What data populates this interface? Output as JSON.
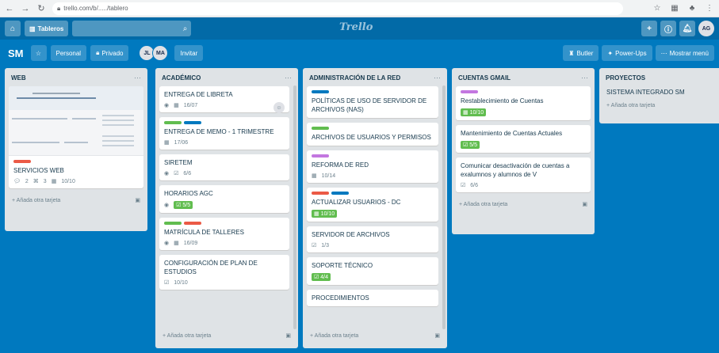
{
  "browser": {
    "url": "trello.com/b/...../tablero"
  },
  "header": {
    "boards_label": "Tableros",
    "logo": "Trello",
    "avatar_initials": "AG"
  },
  "board": {
    "title": "SM",
    "personal": "Personal",
    "privado": "Privado",
    "members": [
      "JL",
      "MA"
    ],
    "invite": "Invitar",
    "butler": "Butler",
    "power_ups": "Power-Ups",
    "show_menu": "Mostrar menú"
  },
  "colors": {
    "green": "#61bd4f",
    "blue": "#0079bf",
    "red": "#eb5a46",
    "purple": "#c377e0"
  },
  "lists": [
    {
      "title": "WEB",
      "cards": [
        {
          "title": "SERVICIOS WEB",
          "labels": [
            "red"
          ],
          "badges": {
            "comments": "2",
            "checklist": "3",
            "date": "10/10"
          }
        }
      ],
      "add": "Añada otra tarjeta"
    },
    {
      "title": "ACADÉMICO",
      "cards": [
        {
          "title": "ENTREGA DE LIBRETA",
          "labels": [],
          "date": "16/07"
        },
        {
          "title": "ENTREGA DE MEMO - 1 TRIMESTRE",
          "labels": [
            "green",
            "blue"
          ],
          "date": "17/06"
        },
        {
          "title": "SIRETEM",
          "labels": [],
          "date": "6/6"
        },
        {
          "title": "HORARIOS AGC",
          "labels": [],
          "date": "5/5"
        },
        {
          "title": "MATRÍCULA DE TALLERES",
          "labels": [
            "green",
            "red"
          ],
          "date": "16/09"
        },
        {
          "title": "CONFIGURACIÓN DE PLAN DE ESTUDIOS",
          "labels": [],
          "date": "10/10"
        }
      ],
      "add": "Añada otra tarjeta"
    },
    {
      "title": "ADMINISTRACIÓN DE LA RED",
      "cards": [
        {
          "title": "POLÍTICAS DE USO DE SERVIDOR DE ARCHIVOS (NAS)",
          "labels": [
            "blue"
          ],
          "date": ""
        },
        {
          "title": "ARCHIVOS DE USUARIOS Y PERMISOS",
          "labels": [
            "green"
          ],
          "date": ""
        },
        {
          "title": "REFORMA DE RED",
          "labels": [
            "purple"
          ],
          "date": "10/14"
        },
        {
          "title": "ACTUALIZAR USUARIOS - DC",
          "labels": [
            "red",
            "blue"
          ],
          "date": "10/10"
        },
        {
          "title": "SERVIDOR DE ARCHIVOS",
          "labels": [],
          "date": "1/3"
        },
        {
          "title": "SOPORTE TÉCNICO",
          "labels": [],
          "date": "4/4"
        },
        {
          "title": "PROCEDIMIENTOS",
          "labels": [],
          "date": ""
        }
      ],
      "add": "Añada otra tarjeta"
    },
    {
      "title": "CUENTAS GMAIL",
      "cards": [
        {
          "title": "Restablecimiento de Cuentas",
          "labels": [
            "purple"
          ],
          "date": "10/10"
        },
        {
          "title": "Mantenimiento de Cuentas Actuales",
          "labels": [],
          "date": "5/5"
        },
        {
          "title": "Comunicar desactivación de cuentas a exalumnos y alumnos de V",
          "labels": [],
          "date": "6/6"
        }
      ],
      "add": "Añada otra tarjeta"
    },
    {
      "title": "PROYECTOS",
      "cards": [
        {
          "title": "SISTEMA INTEGRADO SM",
          "labels": [],
          "date": ""
        }
      ],
      "add": "Añada otra tarjeta"
    }
  ]
}
